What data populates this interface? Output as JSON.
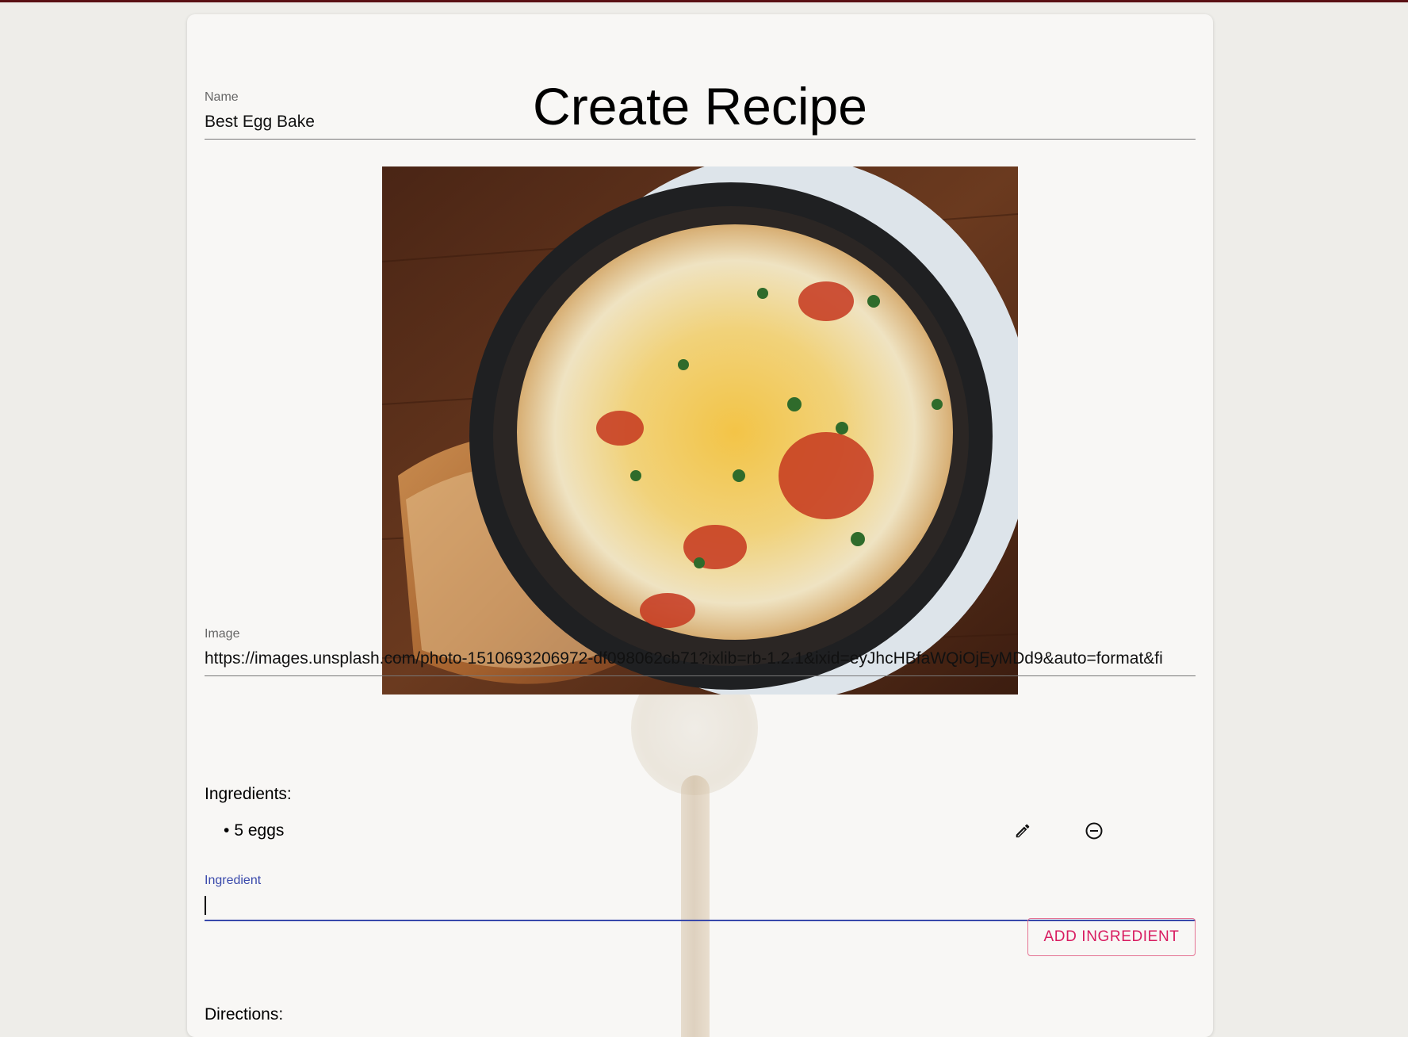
{
  "page": {
    "title": "Create Recipe"
  },
  "form": {
    "name": {
      "label": "Name",
      "value": "Best Egg Bake"
    },
    "image": {
      "label": "Image",
      "value": "https://images.unsplash.com/photo-1510693206972-df098062cb71?ixlib=rb-1.2.1&ixid=eyJhcHBfaWQiOjEyMDd9&auto=format&fi",
      "photo_subject": "egg bake in cast iron skillet with toast"
    },
    "ingredients": {
      "heading": "Ingredients:",
      "items": [
        {
          "bullet": "•",
          "text": "5 eggs",
          "edit_icon": "pencil-icon",
          "remove_icon": "minus-circle-icon"
        }
      ],
      "input": {
        "label": "Ingredient",
        "value": ""
      },
      "add_button_label": "ADD INGREDIENT"
    },
    "directions": {
      "heading": "Directions:"
    }
  },
  "colors": {
    "focus_accent": "#3949ab",
    "button_accent": "#d81b60",
    "top_bar": "#5a1014"
  }
}
